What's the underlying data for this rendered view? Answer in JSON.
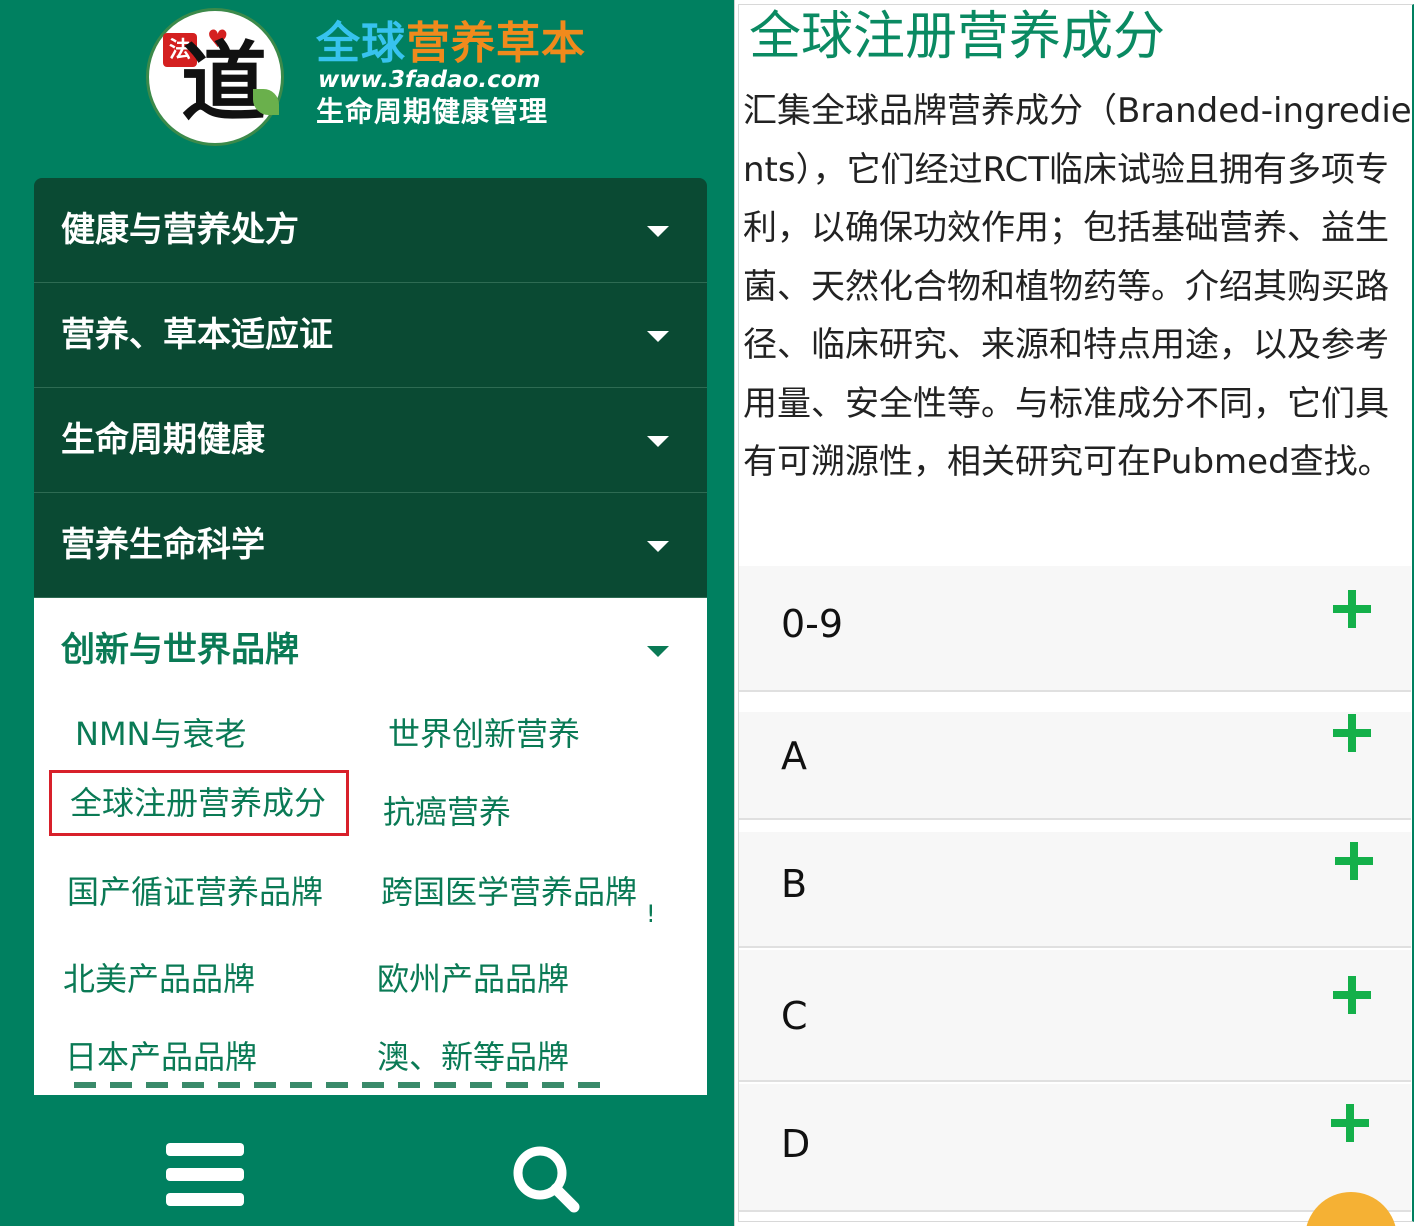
{
  "logo": {
    "seal_char": "道",
    "fa_char": "法",
    "heart": "♥",
    "title_blue": "全球",
    "title_orange": "营养",
    "title_green": "草本",
    "url": "www.3fadao.com",
    "tagline": "生命周期健康管理"
  },
  "menu": {
    "items": [
      {
        "label": "健康与营养处方"
      },
      {
        "label": "营养、草本适应证"
      },
      {
        "label": "生命周期健康"
      },
      {
        "label": "营养生命科学"
      },
      {
        "label": "创新与世界品牌"
      }
    ],
    "submenu": [
      {
        "label": "NMN与衰老"
      },
      {
        "label": "世界创新营养"
      },
      {
        "label": "全球注册营养成分"
      },
      {
        "label": "抗癌营养"
      },
      {
        "label": "国产循证营养品牌"
      },
      {
        "label": "跨国医学营养品牌"
      },
      {
        "label": "北美产品品牌"
      },
      {
        "label": "欧州产品品牌"
      },
      {
        "label": "日本产品品牌"
      },
      {
        "label": "澳、新等品牌"
      }
    ],
    "stray_mark": "!"
  },
  "bottom_bar": {
    "menu_icon": "hamburger-icon",
    "search_icon": "search-icon"
  },
  "content": {
    "title": "全球注册营养成分",
    "description": "汇集全球品牌营养成分（Branded-ingredients），它们经过RCT临床试验且拥有多项专利，以确保功效作用；包括基础营养、益生菌、天然化合物和植物药等。介绍其购买路径、临床研究、来源和特点用途，以及参考用量、安全性等。与标准成分不同，它们具有可溯源性，相关研究可在Pubmed查找。",
    "accordion": [
      {
        "label": "0-9"
      },
      {
        "label": "A"
      },
      {
        "label": "B"
      },
      {
        "label": "C"
      },
      {
        "label": "D"
      }
    ]
  },
  "colors": {
    "brand_green": "#008060",
    "dark_green": "#0a4a33",
    "text_green": "#0a7a55",
    "plus_green": "#14b04a",
    "highlight_red": "#d8202a"
  }
}
